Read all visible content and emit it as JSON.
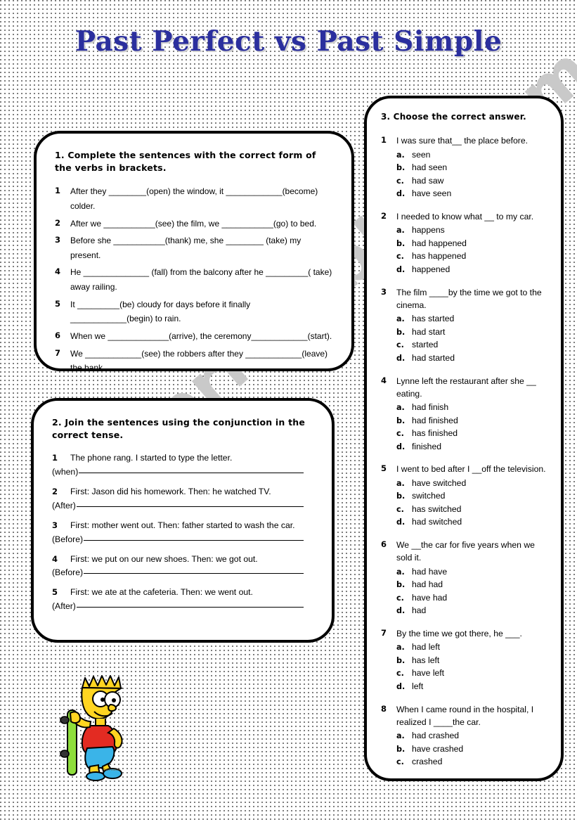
{
  "page": {
    "title": "Past Perfect vs Past Simple",
    "title_color": "#2b2f9e",
    "watermark": "ESLprintables.com",
    "watermark_color": "#c9c9c9",
    "background": "#ffffff",
    "border_color": "#000000"
  },
  "exercise1": {
    "heading": "1. Complete the sentences with the correct form of the verbs in brackets.",
    "items": [
      {
        "num": "1",
        "text": "After they ________(open) the window, it ____________(become) colder."
      },
      {
        "num": "2",
        "text": "After we ___________(see) the film, we ___________(go) to bed."
      },
      {
        "num": "3",
        "text": "Before she ___________(thank) me, she ________ (take) my present."
      },
      {
        "num": "4",
        "text": "He ______________ (fall) from the balcony after he _________( take) away railing."
      },
      {
        "num": "5",
        "text": "It _________(be) cloudy for days before it finally ____________(begin) to rain."
      },
      {
        "num": "6",
        "text": "When we _____________(arrive), the ceremony____________(start)."
      },
      {
        "num": "7",
        "text": "We ____________(see) the robbers after they ____________(leave) the bank."
      }
    ]
  },
  "exercise2": {
    "heading": "2. Join the sentences using the conjunction in the correct tense.",
    "items": [
      {
        "num": "1",
        "text": "The phone rang. I started to type the letter.",
        "conjunction": "(when)"
      },
      {
        "num": "2",
        "text": "First: Jason did his homework. Then: he watched TV.",
        "conjunction": "(After)"
      },
      {
        "num": "3",
        "text": "First: mother went out. Then: father started to wash the car.",
        "conjunction": "(Before)"
      },
      {
        "num": "4",
        "text": "First: we put on our new shoes. Then: we got out.",
        "conjunction": "(Before)"
      },
      {
        "num": "5",
        "text": "First: we ate at the cafeteria. Then: we went out.",
        "conjunction": "(After)"
      }
    ]
  },
  "exercise3": {
    "heading": "3. Choose the correct answer.",
    "items": [
      {
        "num": "1",
        "stem": "I was sure that__ the place before.",
        "options": [
          {
            "letter": "a.",
            "text": "seen"
          },
          {
            "letter": "b.",
            "text": "had seen"
          },
          {
            "letter": "c.",
            "text": "had saw"
          },
          {
            "letter": "d.",
            "text": "have seen"
          }
        ]
      },
      {
        "num": "2",
        "stem": "I needed to know what __ to my car.",
        "options": [
          {
            "letter": "a.",
            "text": "happens"
          },
          {
            "letter": "b.",
            "text": "had happened"
          },
          {
            "letter": "c.",
            "text": "has happened"
          },
          {
            "letter": "d.",
            "text": "happened"
          }
        ]
      },
      {
        "num": "3",
        "stem": "The film ____by the time we got to the cinema.",
        "options": [
          {
            "letter": "a.",
            "text": "has started"
          },
          {
            "letter": "b.",
            "text": "had start"
          },
          {
            "letter": "c.",
            "text": "started"
          },
          {
            "letter": "d.",
            "text": "had started"
          }
        ]
      },
      {
        "num": "4",
        "stem": "Lynne left the restaurant after she __ eating.",
        "options": [
          {
            "letter": "a.",
            "text": "had finish"
          },
          {
            "letter": "b.",
            "text": "had finished"
          },
          {
            "letter": "c.",
            "text": "has finished"
          },
          {
            "letter": "d.",
            "text": "finished"
          }
        ]
      },
      {
        "num": "5",
        "stem": "I went to bed after I __off the television.",
        "options": [
          {
            "letter": "a.",
            "text": "have switched"
          },
          {
            "letter": "b.",
            "text": "switched"
          },
          {
            "letter": "c.",
            "text": "has switched"
          },
          {
            "letter": "d.",
            "text": "had switched"
          }
        ]
      },
      {
        "num": "6",
        "stem": "We __the car for five years when we sold it.",
        "options": [
          {
            "letter": "a.",
            "text": "had have"
          },
          {
            "letter": "b.",
            "text": "had had"
          },
          {
            "letter": "c.",
            "text": "have had"
          },
          {
            "letter": "d.",
            "text": "had"
          }
        ]
      },
      {
        "num": "7",
        "stem": "By the time we got there, he ___.",
        "options": [
          {
            "letter": "a.",
            "text": "had left"
          },
          {
            "letter": "b.",
            "text": "has left"
          },
          {
            "letter": "c.",
            "text": "have left"
          },
          {
            "letter": "d.",
            "text": "left"
          }
        ]
      },
      {
        "num": "8",
        "stem": "When I came round in the hospital, I realized I ____the car.",
        "options": [
          {
            "letter": "a.",
            "text": "had crashed"
          },
          {
            "letter": "b.",
            "text": "have crashed"
          },
          {
            "letter": "c.",
            "text": "crashed"
          }
        ]
      }
    ]
  },
  "illustration": {
    "name": "bart-simpson-skateboard",
    "credit": "bart colour",
    "colors": {
      "skin": "#ffd521",
      "shirt": "#e32b22",
      "shorts": "#3ab4e8",
      "shoes": "#3ab4e8",
      "board": "#8ede3b",
      "outline": "#000000"
    }
  }
}
